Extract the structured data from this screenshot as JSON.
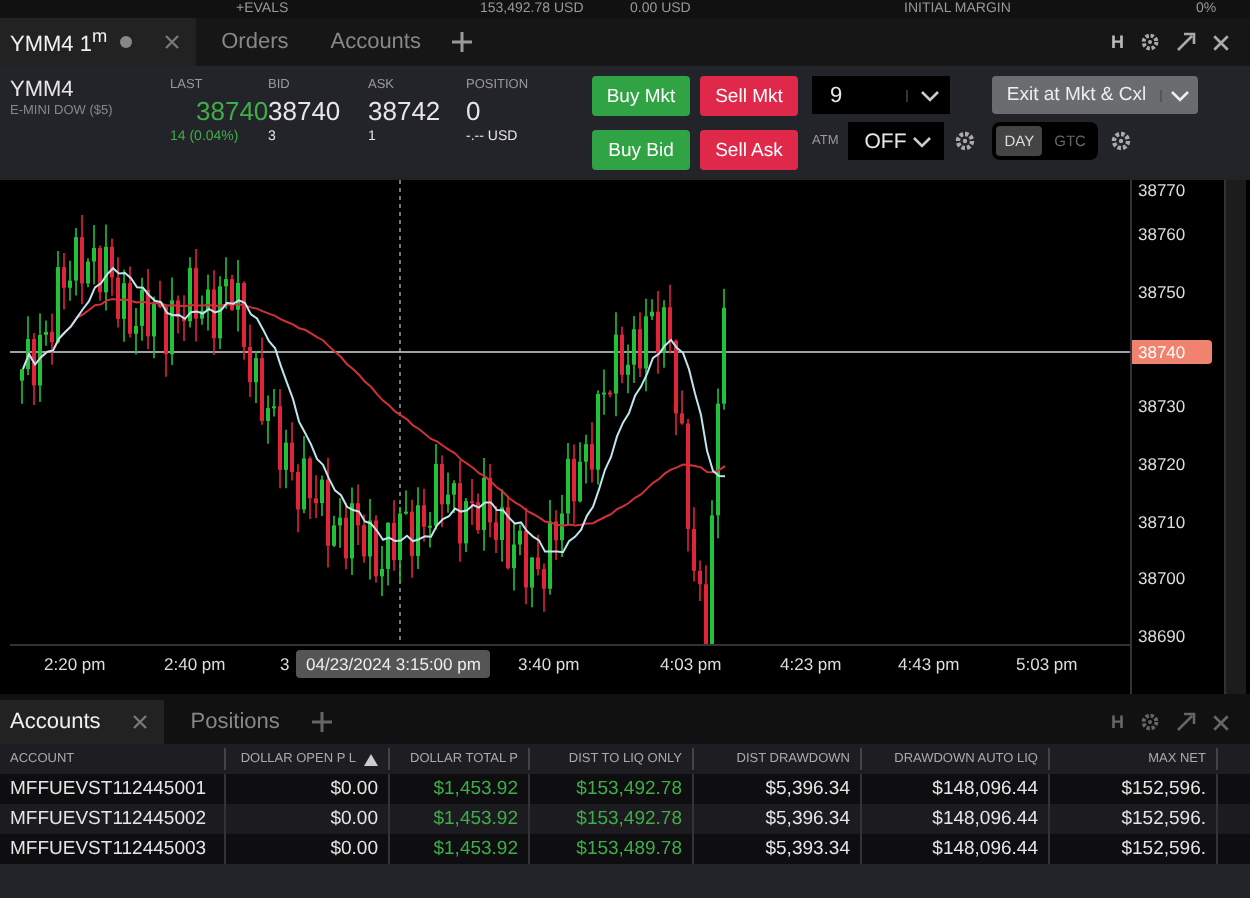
{
  "top_strip": [
    "+EVALS",
    "153,492.78 USD",
    "0.00 USD",
    "INITIAL MARGIN",
    "0%"
  ],
  "chart_window": {
    "tabs": [
      {
        "label": "YMM4 1$^{m}$",
        "selected": true,
        "closable": true
      },
      {
        "label": "Orders",
        "selected": false,
        "closable": false
      },
      {
        "label": "Accounts",
        "selected": false,
        "closable": false
      }
    ],
    "header_letter": "H"
  },
  "quote": {
    "symbol": "YMM4",
    "description": "E-MINI DOW ($5)",
    "fields": [
      {
        "label": "LAST",
        "value": "38740",
        "sub": "14 (0.04%)",
        "kind": "change"
      },
      {
        "label": "BID",
        "value": "38740",
        "sub": "3",
        "kind": "plain"
      },
      {
        "label": "ASK",
        "value": "38742",
        "sub": "1",
        "kind": "plain"
      },
      {
        "label": "POSITION",
        "value": "0",
        "sub": "-.-- USD",
        "kind": "plain"
      }
    ],
    "buttons": [
      {
        "label": "Buy Mkt",
        "kind": "buy"
      },
      {
        "label": "Sell Mkt",
        "kind": "sell"
      },
      {
        "label": "Buy Bid",
        "kind": "buy"
      },
      {
        "label": "Sell Ask",
        "kind": "sell"
      }
    ],
    "quantity": "9",
    "exit_button": "Exit at Mkt & Cxl",
    "atm_label": "ATM",
    "atm_value": "OFF",
    "tif": [
      {
        "label": "DAY",
        "selected": true
      },
      {
        "label": "GTC",
        "selected": false
      }
    ]
  },
  "chart": {
    "price_labels": [
      "38770",
      "38760",
      "38750",
      "38730",
      "38720",
      "38710",
      "38700",
      "38690"
    ],
    "current_price": "38740",
    "time_labels": [
      "2:20 pm",
      "2:40 pm",
      "3",
      "3:40 pm",
      "4:03 pm",
      "4:23 pm",
      "4:43 pm",
      "5:03 pm"
    ],
    "crosshair_time": "04/23/2024 3:15:00 pm"
  },
  "accounts_window": {
    "tabs": [
      {
        "label": "Accounts",
        "selected": true,
        "closable": true
      },
      {
        "label": "Positions",
        "selected": false,
        "closable": false
      }
    ],
    "header_letter": "H",
    "columns": [
      {
        "label": "ACCOUNT",
        "sorted": false,
        "color": "#e6e6e6"
      },
      {
        "label": "DOLLAR OPEN P L",
        "sorted": true,
        "color": "#e6e6e6"
      },
      {
        "label": "DOLLAR TOTAL P",
        "sorted": false,
        "color": "#3fae49"
      },
      {
        "label": "DIST TO LIQ ONLY",
        "sorted": false,
        "color": "#3fae49"
      },
      {
        "label": "DIST DRAWDOWN",
        "sorted": false,
        "color": "#e6e6e6"
      },
      {
        "label": "DRAWDOWN AUTO LIQ",
        "sorted": false,
        "color": "#e6e6e6"
      },
      {
        "label": "MAX NET",
        "sorted": false,
        "color": "#e6e6e6"
      }
    ],
    "rows": [
      [
        "MFFUEVST112445001",
        "$0.00",
        "$1,453.92",
        "$153,492.78",
        "$5,396.34",
        "$148,096.44",
        "$152,596."
      ],
      [
        "MFFUEVST112445002",
        "$0.00",
        "$1,453.92",
        "$153,492.78",
        "$5,396.34",
        "$148,096.44",
        "$152,596."
      ],
      [
        "MFFUEVST112445003",
        "$0.00",
        "$1,453.92",
        "$153,489.78",
        "$5,393.34",
        "$148,096.44",
        "$152,596."
      ]
    ]
  }
}
